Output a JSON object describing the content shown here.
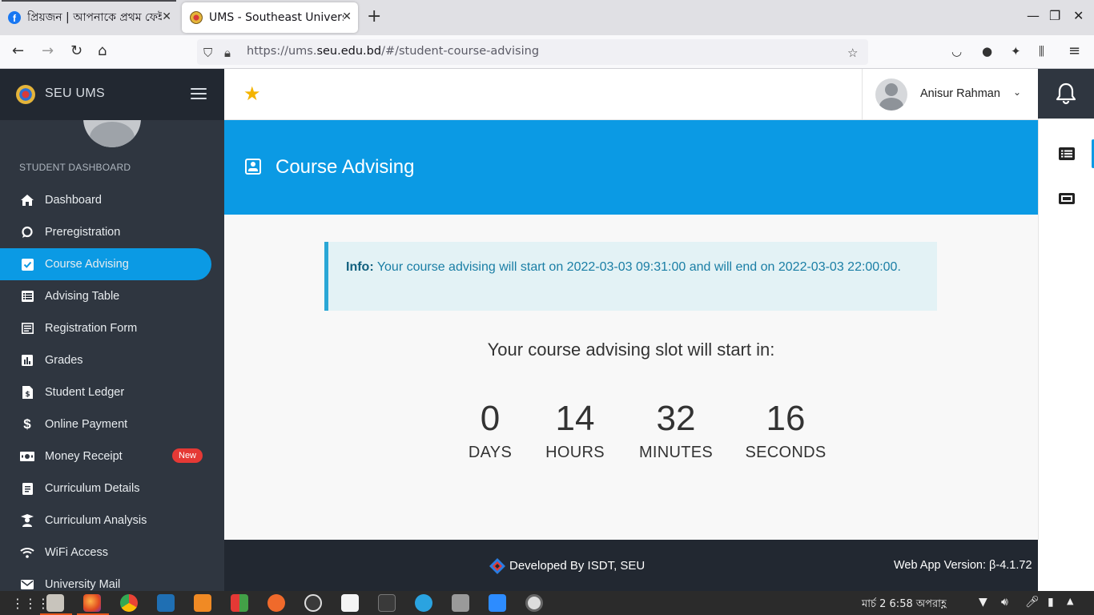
{
  "browser": {
    "tabs": [
      {
        "title": "প্রিয়জন | আপনাকে প্রথম ফেইজ"
      },
      {
        "title": "UMS - Southeast Universi"
      }
    ],
    "url_prefix": "https://ums.",
    "url_host": "seu.edu.bd",
    "url_path": "/#/student-course-advising"
  },
  "sidebar": {
    "brand": "SEU UMS",
    "section_label": "STUDENT DASHBOARD",
    "items": [
      {
        "label": "Dashboard",
        "icon": "home-icon"
      },
      {
        "label": "Preregistration",
        "icon": "comment-icon"
      },
      {
        "label": "Course Advising",
        "icon": "check-square-icon",
        "active": true
      },
      {
        "label": "Advising Table",
        "icon": "list-icon"
      },
      {
        "label": "Registration Form",
        "icon": "form-icon"
      },
      {
        "label": "Grades",
        "icon": "bar-chart-icon"
      },
      {
        "label": "Student Ledger",
        "icon": "ledger-icon"
      },
      {
        "label": "Online Payment",
        "icon": "dollar-icon"
      },
      {
        "label": "Money Receipt",
        "icon": "money-icon",
        "badge": "New"
      },
      {
        "label": "Curriculum Details",
        "icon": "book-icon"
      },
      {
        "label": "Curriculum Analysis",
        "icon": "graduate-icon"
      },
      {
        "label": "WiFi Access",
        "icon": "wifi-icon"
      },
      {
        "label": "University Mail",
        "icon": "mail-icon"
      }
    ]
  },
  "header": {
    "user_name": "Anisur Rahman"
  },
  "page": {
    "title": "Course Advising",
    "info_label": "Info:",
    "info_text": " Your course advising will start on 2022-03-03 09:31:00 and will end on 2022-03-03 22:00:00.",
    "countdown_heading": "Your course advising slot will start in:",
    "countdown": [
      {
        "value": "0",
        "label": "DAYS"
      },
      {
        "value": "14",
        "label": "HOURS"
      },
      {
        "value": "32",
        "label": "MINUTES"
      },
      {
        "value": "16",
        "label": "SECONDS"
      }
    ]
  },
  "footer": {
    "developed_by": "Developed By ISDT, SEU",
    "version": "Web App Version: β-4.1.72"
  },
  "taskbar": {
    "clock": "মার্চ 2   6:58 অপরাহ্ণ"
  },
  "colors": {
    "accent": "#0b9ae4",
    "sidebar_bg": "#2f3640",
    "badge_red": "#e53935"
  }
}
